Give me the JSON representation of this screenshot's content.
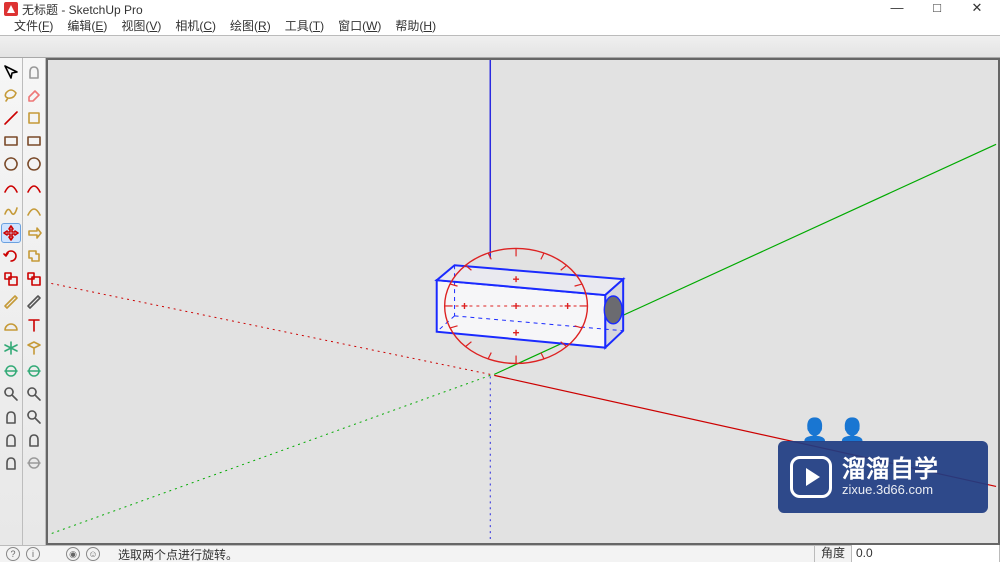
{
  "title": "无标题 - SketchUp Pro",
  "menu": [
    {
      "label": "文件",
      "hotkey": "F"
    },
    {
      "label": "编辑",
      "hotkey": "E"
    },
    {
      "label": "视图",
      "hotkey": "V"
    },
    {
      "label": "相机",
      "hotkey": "C"
    },
    {
      "label": "绘图",
      "hotkey": "R"
    },
    {
      "label": "工具",
      "hotkey": "T"
    },
    {
      "label": "窗口",
      "hotkey": "W"
    },
    {
      "label": "帮助",
      "hotkey": "H"
    }
  ],
  "win_controls": {
    "min": "—",
    "max": "□",
    "close": "✕"
  },
  "status": {
    "hint": "选取两个点进行旋转。",
    "measure_label": "角度",
    "measure_value": "0.0"
  },
  "watermark": {
    "main": "溜溜自学",
    "sub": "zixue.3d66.com"
  },
  "toolbars": {
    "col1": [
      {
        "name": "select-tool-icon",
        "color": "#000"
      },
      {
        "name": "lasso-tool-icon",
        "color": "#c59a38"
      },
      {
        "name": "line-tool-icon",
        "color": "#c00"
      },
      {
        "name": "rectangle-tool-icon",
        "color": "#7a4a29"
      },
      {
        "name": "circle-tool-icon",
        "color": "#7a4a29"
      },
      {
        "name": "arc-tool-icon",
        "color": "#c00"
      },
      {
        "name": "freehand-tool-icon",
        "color": "#c59a38"
      },
      {
        "name": "move-tool-icon",
        "color": "#c00",
        "active": true
      },
      {
        "name": "rotate-tool-icon",
        "color": "#c00"
      },
      {
        "name": "scale-tool-icon",
        "color": "#c00"
      },
      {
        "name": "tape-measure-tool-icon",
        "color": "#c59a38"
      },
      {
        "name": "protractor-tool-icon",
        "color": "#c59a38"
      },
      {
        "name": "axes-tool-icon",
        "color": "#3a7"
      },
      {
        "name": "orbit-tool-icon",
        "color": "#3a7"
      },
      {
        "name": "zoom-tool-icon",
        "color": "#555"
      },
      {
        "name": "pan-tool-icon",
        "color": "#555"
      },
      {
        "name": "walk-tool-icon",
        "color": "#555"
      },
      {
        "name": "position-camera-tool-icon",
        "color": "#555"
      }
    ],
    "col2": [
      {
        "name": "make-component-icon",
        "color": "#999"
      },
      {
        "name": "eraser-tool-icon",
        "color": "#e77"
      },
      {
        "name": "paint-bucket-tool-icon",
        "color": "#c59a38"
      },
      {
        "name": "rotated-rectangle-tool-icon",
        "color": "#7a4a29"
      },
      {
        "name": "polygon-tool-icon",
        "color": "#7a4a29"
      },
      {
        "name": "two-point-arc-tool-icon",
        "color": "#c00"
      },
      {
        "name": "pie-tool-icon",
        "color": "#c59a38"
      },
      {
        "name": "push-pull-tool-icon",
        "color": "#c59a38"
      },
      {
        "name": "follow-me-tool-icon",
        "color": "#c59a38"
      },
      {
        "name": "offset-tool-icon",
        "color": "#c00"
      },
      {
        "name": "dimensions-tool-icon",
        "color": "#555"
      },
      {
        "name": "text-tool-icon",
        "color": "#c00"
      },
      {
        "name": "section-plane-tool-icon",
        "color": "#c59a38"
      },
      {
        "name": "look-around-tool-icon",
        "color": "#3a7"
      },
      {
        "name": "zoom-extents-tool-icon",
        "color": "#555"
      },
      {
        "name": "zoom-window-tool-icon",
        "color": "#555"
      },
      {
        "name": "previous-tool-icon",
        "color": "#555"
      },
      {
        "name": "look-around-icon",
        "color": "#999"
      }
    ]
  }
}
